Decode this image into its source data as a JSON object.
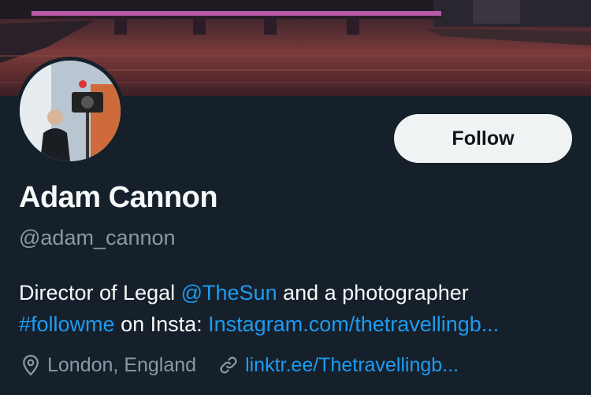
{
  "profile": {
    "name": "Adam Cannon",
    "handle": "@adam_cannon",
    "follow_label": "Follow",
    "bio": {
      "text1": "Director of Legal ",
      "mention": "@TheSun",
      "text2": " and a photographer",
      "hashtag": "#followme",
      "text3": " on Insta: ",
      "link": "Instagram.com/thetravellingb..."
    },
    "location": "London, England",
    "website": "linktr.ee/Thetravellingb..."
  },
  "icons": {
    "location": "location-pin-icon",
    "website": "link-icon"
  },
  "colors": {
    "background": "#15202b",
    "link": "#1d9bf0",
    "secondary_text": "#8b98a5",
    "button_bg": "#eff3f4"
  }
}
